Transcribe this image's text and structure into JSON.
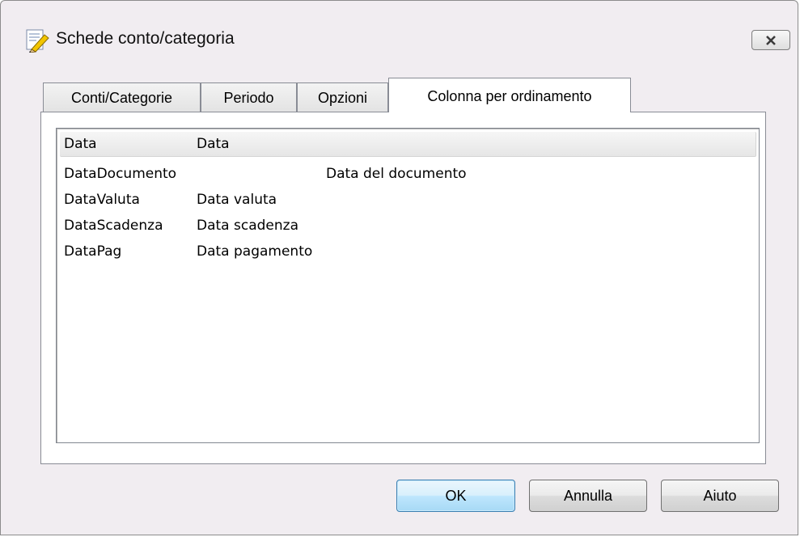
{
  "window": {
    "title": "Schede conto/categoria",
    "close_symbol": "✕",
    "app_icon": "document-pencil-icon"
  },
  "tabs": [
    {
      "label": "Conti/Categorie",
      "active": false
    },
    {
      "label": "Periodo",
      "active": false
    },
    {
      "label": "Opzioni",
      "active": false
    },
    {
      "label": "Colonna per ordinamento",
      "active": true
    }
  ],
  "list": {
    "rows": [
      {
        "name": "Data",
        "description": "Data",
        "selected": true
      },
      {
        "name": "DataDocumento",
        "description": "Data del documento",
        "selected": false
      },
      {
        "name": "DataValuta",
        "description": "Data valuta",
        "selected": false
      },
      {
        "name": "DataScadenza",
        "description": "Data scadenza",
        "selected": false
      },
      {
        "name": "DataPag",
        "description": "Data pagamento",
        "selected": false
      }
    ]
  },
  "buttons": {
    "ok": "OK",
    "cancel": "Annulla",
    "help": "Aiuto"
  },
  "colors": {
    "window_bg": "#f1edf1",
    "default_button_border": "#3c7fb1"
  }
}
